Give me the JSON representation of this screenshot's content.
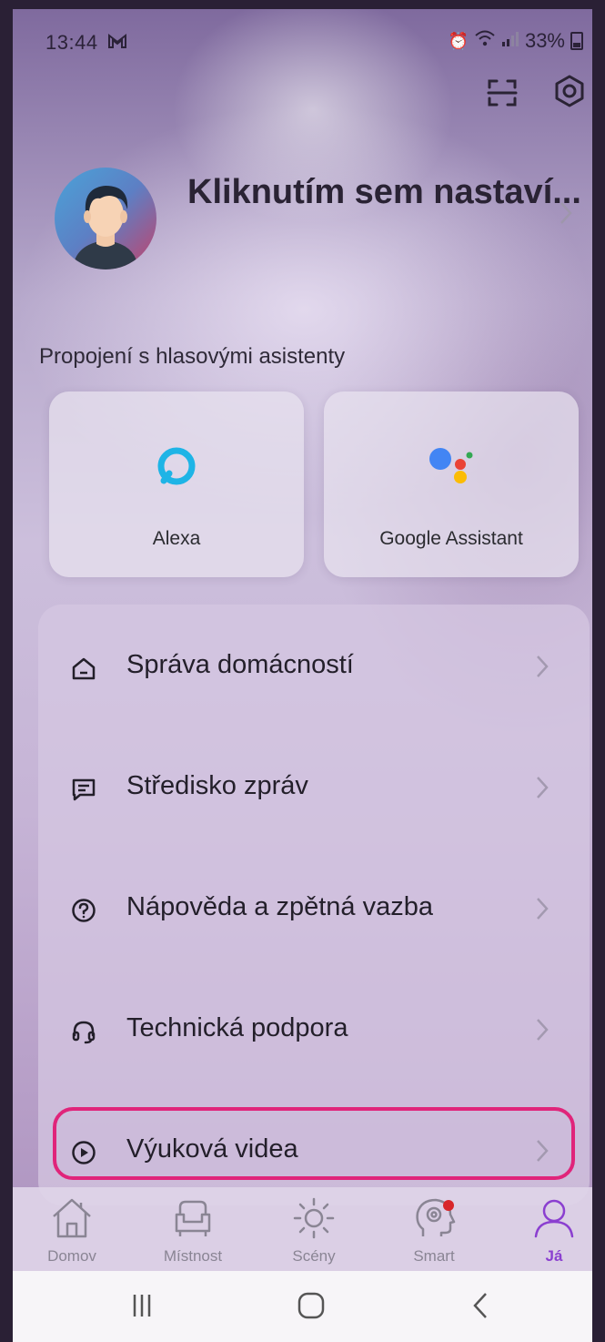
{
  "status_bar": {
    "time": "13:44",
    "notification_icon": "gmail-icon",
    "battery": "33%"
  },
  "header": {
    "scan_icon": "scan-icon",
    "settings_icon": "settings-icon"
  },
  "profile": {
    "name_prompt": "Kliknutím sem nastaví..."
  },
  "voice_assistants": {
    "title": "Propojení s hlasovými asistenty",
    "cards": [
      {
        "label": "Alexa",
        "icon": "alexa-icon"
      },
      {
        "label": "Google Assistant",
        "icon": "google-assistant-icon"
      }
    ]
  },
  "menu": {
    "items": [
      {
        "label": "Správa domácností",
        "icon": "home-icon"
      },
      {
        "label": "Středisko zpráv",
        "icon": "message-icon"
      },
      {
        "label": "Nápověda a zpětná vazba",
        "icon": "help-icon"
      },
      {
        "label": "Technická podpora",
        "icon": "headset-icon"
      },
      {
        "label": "Výuková videa",
        "icon": "play-icon"
      }
    ],
    "highlight_color": "#e0247a"
  },
  "bottom_nav": {
    "items": [
      {
        "label": "Domov",
        "icon": "house-icon"
      },
      {
        "label": "Místnost",
        "icon": "armchair-icon"
      },
      {
        "label": "Scény",
        "icon": "sun-icon"
      },
      {
        "label": "Smart",
        "icon": "brain-icon"
      },
      {
        "label": "Já",
        "icon": "person-icon"
      }
    ],
    "active": "Já",
    "active_color": "#8b3fd0"
  }
}
